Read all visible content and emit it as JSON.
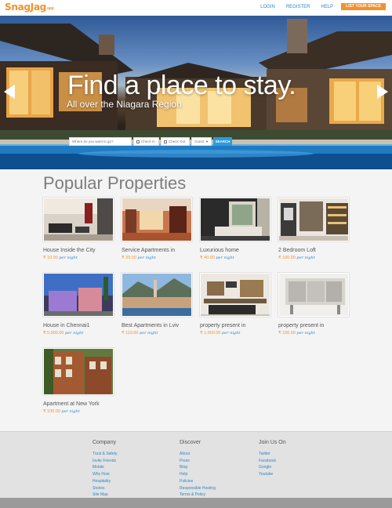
{
  "header": {
    "logo": "SnagJag",
    "logo_mark": "app",
    "nav": [
      "LOGIN",
      "REGISTER",
      "HELP"
    ],
    "cta": "LIST YOUR SPACE"
  },
  "hero": {
    "title": "Find a place to stay.",
    "subtitle": "All over the Niagara Region",
    "search": {
      "where_placeholder": "Where do you want to go?",
      "check_in": "Check In",
      "check_out": "Check Out",
      "guests": "Guest",
      "button": "SEARCH"
    }
  },
  "properties": {
    "title": "Popular Properties",
    "per_night": "per night",
    "items": [
      {
        "title": "House Inside the City",
        "price": "₹ 10.00"
      },
      {
        "title": "Service Apartments in",
        "price": "₹ 39.00"
      },
      {
        "title": "Luxurious home",
        "price": "₹ 40.00"
      },
      {
        "title": "2 Bedroom Loft",
        "price": "₹ 100.00"
      },
      {
        "title": "House in Chennai1",
        "price": "₹ 5,000.00"
      },
      {
        "title": "Best Apartments in Lviv",
        "price": "₹ 110.00"
      },
      {
        "title": "property present in",
        "price": "₹ 1,000.00"
      },
      {
        "title": "property present in",
        "price": "₹ 100.00"
      },
      {
        "title": "Apartment at New York",
        "price": "₹ 100.00"
      }
    ]
  },
  "footer": {
    "company": {
      "title": "Company",
      "links": [
        "Trust & Safety",
        "Invite Friends",
        "Mobile",
        "Why Host",
        "Hospitality",
        "Stories",
        "Site Map"
      ]
    },
    "discover": {
      "title": "Discover",
      "links": [
        "About",
        "Press",
        "Blog",
        "Help",
        "Policies",
        "Responsible Hosting",
        "Terms & Policy"
      ]
    },
    "social": {
      "title": "Join Us On",
      "links": [
        "Twitter",
        "Facebook",
        "Google",
        "Youtube"
      ]
    }
  },
  "colors": {
    "accent": "#f2922b",
    "link": "#2b88c8",
    "search": "#2b9be0"
  }
}
